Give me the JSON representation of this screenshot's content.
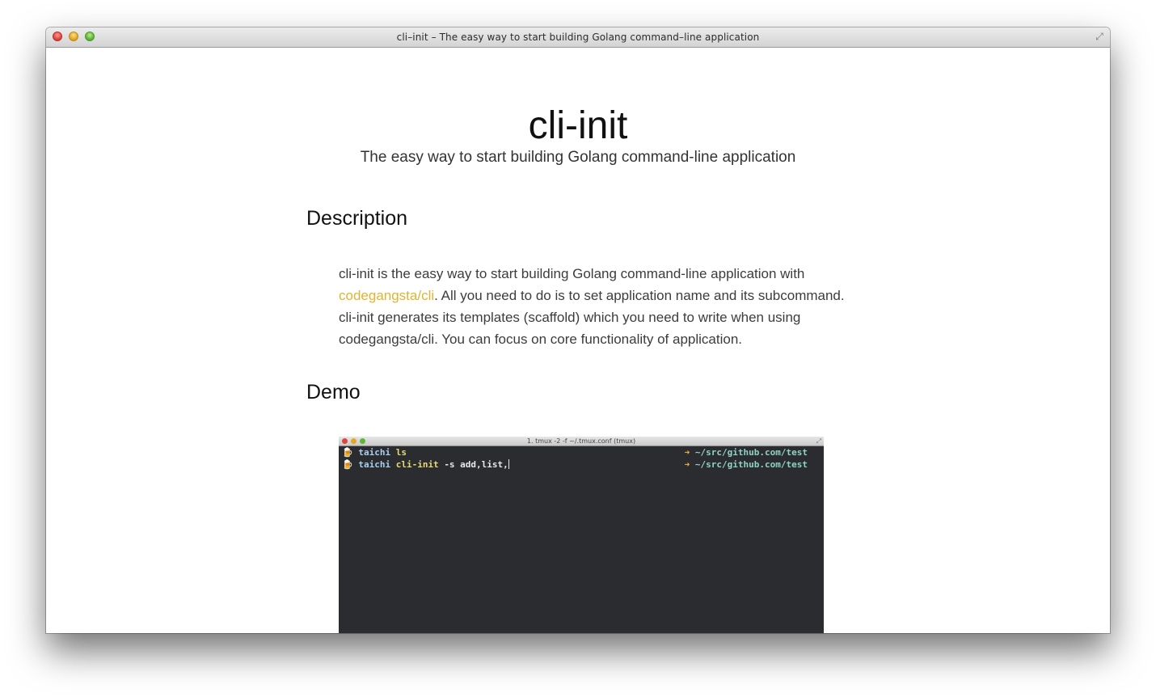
{
  "window": {
    "title": "cli–init – The easy way to start building Golang command–line application"
  },
  "page": {
    "title": "cli-init",
    "subtitle": "The easy way to start building Golang command-line application"
  },
  "description": {
    "heading": "Description",
    "text_before_link": "cli-init is the easy way to start building Golang command-line application with ",
    "link_text": "codegangsta/cli",
    "text_after_link": ". All you need to do is to set application name and its subcommand. cli-init generates its templates (scaffold) which you need to write when using codegangsta/cli. You can focus on core functionality of application."
  },
  "demo": {
    "heading": "Demo",
    "terminal": {
      "title": "1. tmux -2 -f ~/.tmux.conf (tmux)",
      "lines": [
        {
          "prompt_icon": "🍺",
          "user": "taichi",
          "command": "ls",
          "args": "",
          "arrow": "➜",
          "path": "~/src/github.com/test"
        },
        {
          "prompt_icon": "🍺",
          "user": "taichi",
          "command": "cli-init",
          "args": "-s add,list,",
          "arrow": "➜",
          "path": "~/src/github.com/test"
        }
      ]
    }
  },
  "colors": {
    "link": "#e0b431",
    "terminal_bg": "#2b2c2f"
  }
}
